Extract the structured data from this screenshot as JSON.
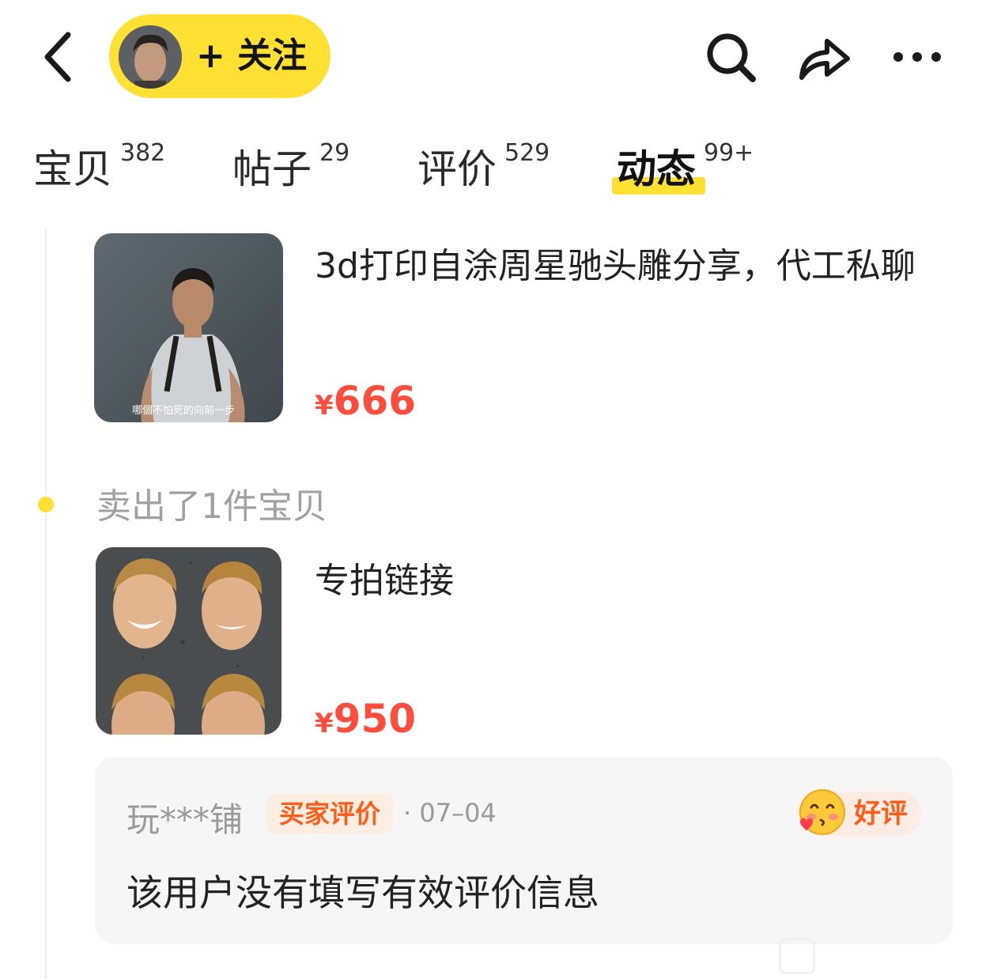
{
  "header": {
    "follow_label": "+ 关注",
    "icons": [
      "back-chevron-icon",
      "search-icon",
      "share-arrow-icon",
      "more-dots-icon"
    ]
  },
  "tabs": [
    {
      "label": "宝贝",
      "count": "382",
      "active": false
    },
    {
      "label": "帖子",
      "count": "29",
      "active": false
    },
    {
      "label": "评价",
      "count": "529",
      "active": false
    },
    {
      "label": "动态",
      "count": "99+",
      "active": true
    }
  ],
  "feed": {
    "items": [
      {
        "title": "3d打印自涂周星驰头雕分享，代工私聊",
        "price_symbol": "¥",
        "price_value": "666",
        "thumb_caption": "哪個不怕死的向前一步"
      },
      {
        "title": "专拍链接",
        "price_symbol": "¥",
        "price_value": "950"
      }
    ],
    "sold_note": "卖出了1件宝贝",
    "review": {
      "reviewer": "玩***铺",
      "badge": "买家评价",
      "date": "· 07–04",
      "rating": "好评",
      "text": "该用户没有填写有效评价信息"
    }
  },
  "colors": {
    "accent_yellow": "#ffe033",
    "price_red": "#ff4d3d",
    "badge_orange": "#ff5b19",
    "card_bg": "#f6f6f6"
  }
}
